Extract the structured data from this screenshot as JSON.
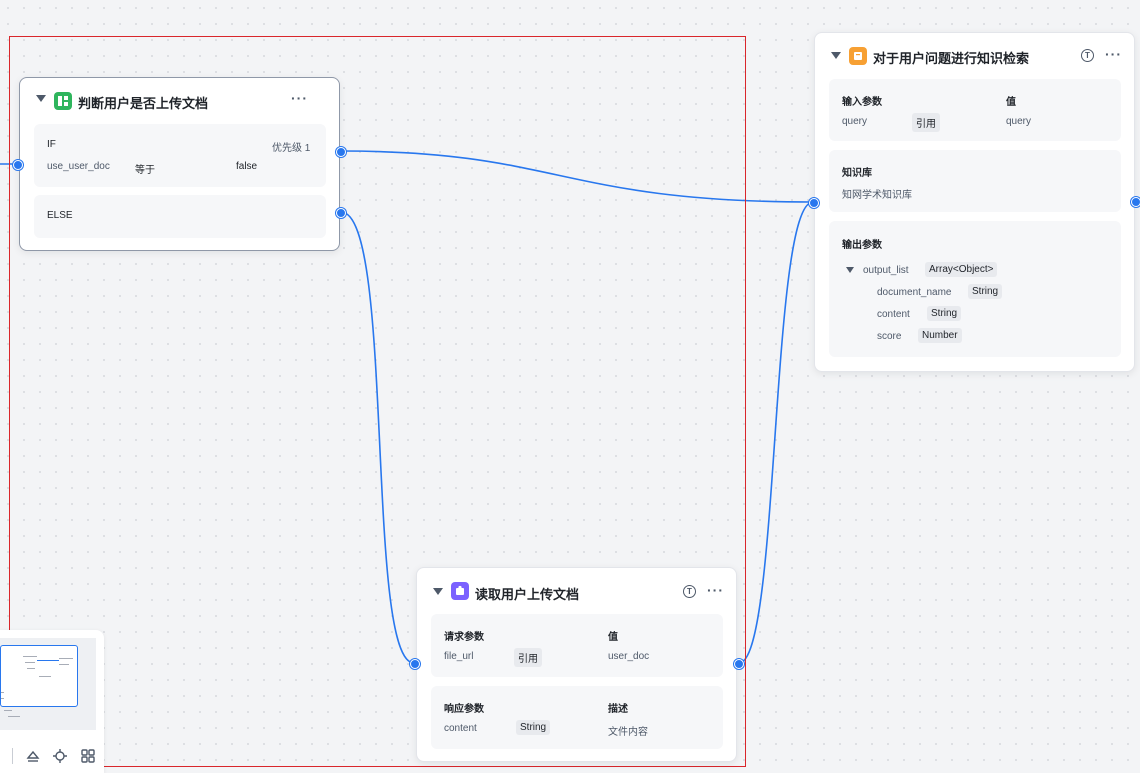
{
  "nodes": {
    "condition": {
      "title": "判断用户是否上传文档",
      "if_label": "IF",
      "priority": "优先级 1",
      "variable": "use_user_doc",
      "operator": "等于",
      "value": "false",
      "else_label": "ELSE"
    },
    "knowledge": {
      "title": "对于用户问题进行知识检索",
      "input": {
        "header_param": "输入参数",
        "header_value": "值",
        "param": "query",
        "ref": "引用",
        "value": "query"
      },
      "kb": {
        "header": "知识库",
        "name": "知网学术知识库"
      },
      "output": {
        "header": "输出参数",
        "items": [
          {
            "name": "output_list",
            "type": "Array<Object>"
          },
          {
            "name": "document_name",
            "type": "String"
          },
          {
            "name": "content",
            "type": "String"
          },
          {
            "name": "score",
            "type": "Number"
          }
        ]
      }
    },
    "plugin": {
      "title": "读取用户上传文档",
      "request": {
        "header_param": "请求参数",
        "header_value": "值",
        "param": "file_url",
        "ref": "引用",
        "value": "user_doc"
      },
      "response": {
        "header_param": "响应参数",
        "header_desc": "描述",
        "param": "content",
        "type": "String",
        "desc": "文件内容"
      }
    }
  },
  "icons": {
    "collapse": "triangle-down-icon",
    "condition": "branch-icon",
    "knowledge": "knowledge-base-icon",
    "plugin": "plugin-icon",
    "more": "more-icon",
    "info": "info-icon",
    "minimap_tools": [
      "upload-icon",
      "locate-icon",
      "grid-icon"
    ]
  },
  "colors": {
    "edge": "#2877ee",
    "selection": "#d9262b",
    "condition_icon": "#2fb55d",
    "knowledge_icon": "#f7a033",
    "plugin_icon": "#7b61ff"
  }
}
